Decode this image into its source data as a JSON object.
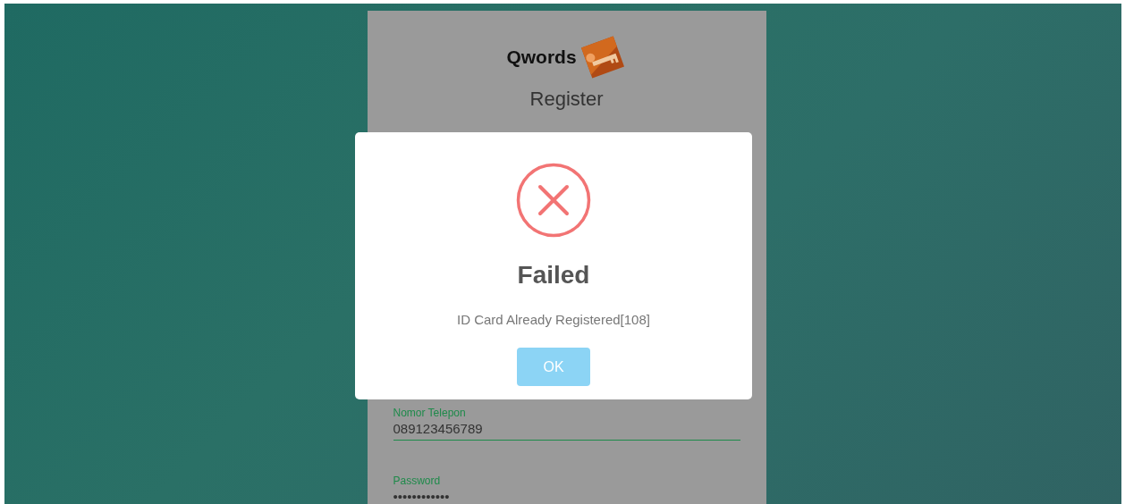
{
  "brand": {
    "name": "Qwords"
  },
  "page_title": "Register",
  "fields": [
    {
      "label": "Nomor Telepon",
      "value": "089123456789"
    },
    {
      "label": "Password",
      "value": "••••••••••••"
    }
  ],
  "dialog": {
    "kind": "error",
    "title": "Failed",
    "message": "ID Card Already Registered[108]",
    "buttons": [
      {
        "label": "OK",
        "disabled": true
      }
    ]
  }
}
